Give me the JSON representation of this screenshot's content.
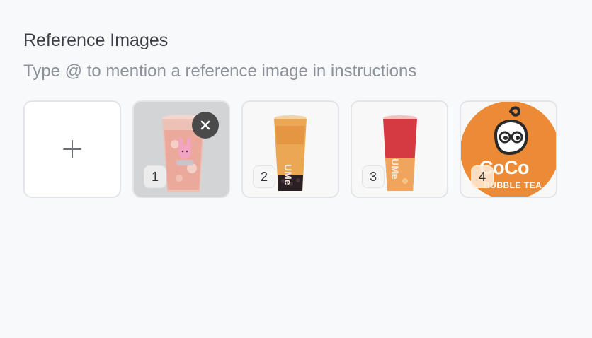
{
  "reference_images": {
    "title": "Reference Images",
    "hint": "Type @ to mention a reference image in instructions",
    "add_icon": "plus-icon",
    "remove_icon": "close-icon",
    "items": [
      {
        "number": "1",
        "image": "pink bubble tea cup with bunny print",
        "selected": true
      },
      {
        "number": "2",
        "image": "orange brown sugar bubble tea cup"
      },
      {
        "number": "3",
        "image": "red and orange layered fruit tea cup"
      },
      {
        "number": "4",
        "image": "CoCo bubble tea logo",
        "logo_text": "CoCo",
        "logo_sub": "BUBBLE TEA"
      }
    ]
  },
  "colors": {
    "page_bg": "#f8f9fa",
    "coco_orange": "#ec8a35",
    "remove_button": "#4a4a4a"
  }
}
